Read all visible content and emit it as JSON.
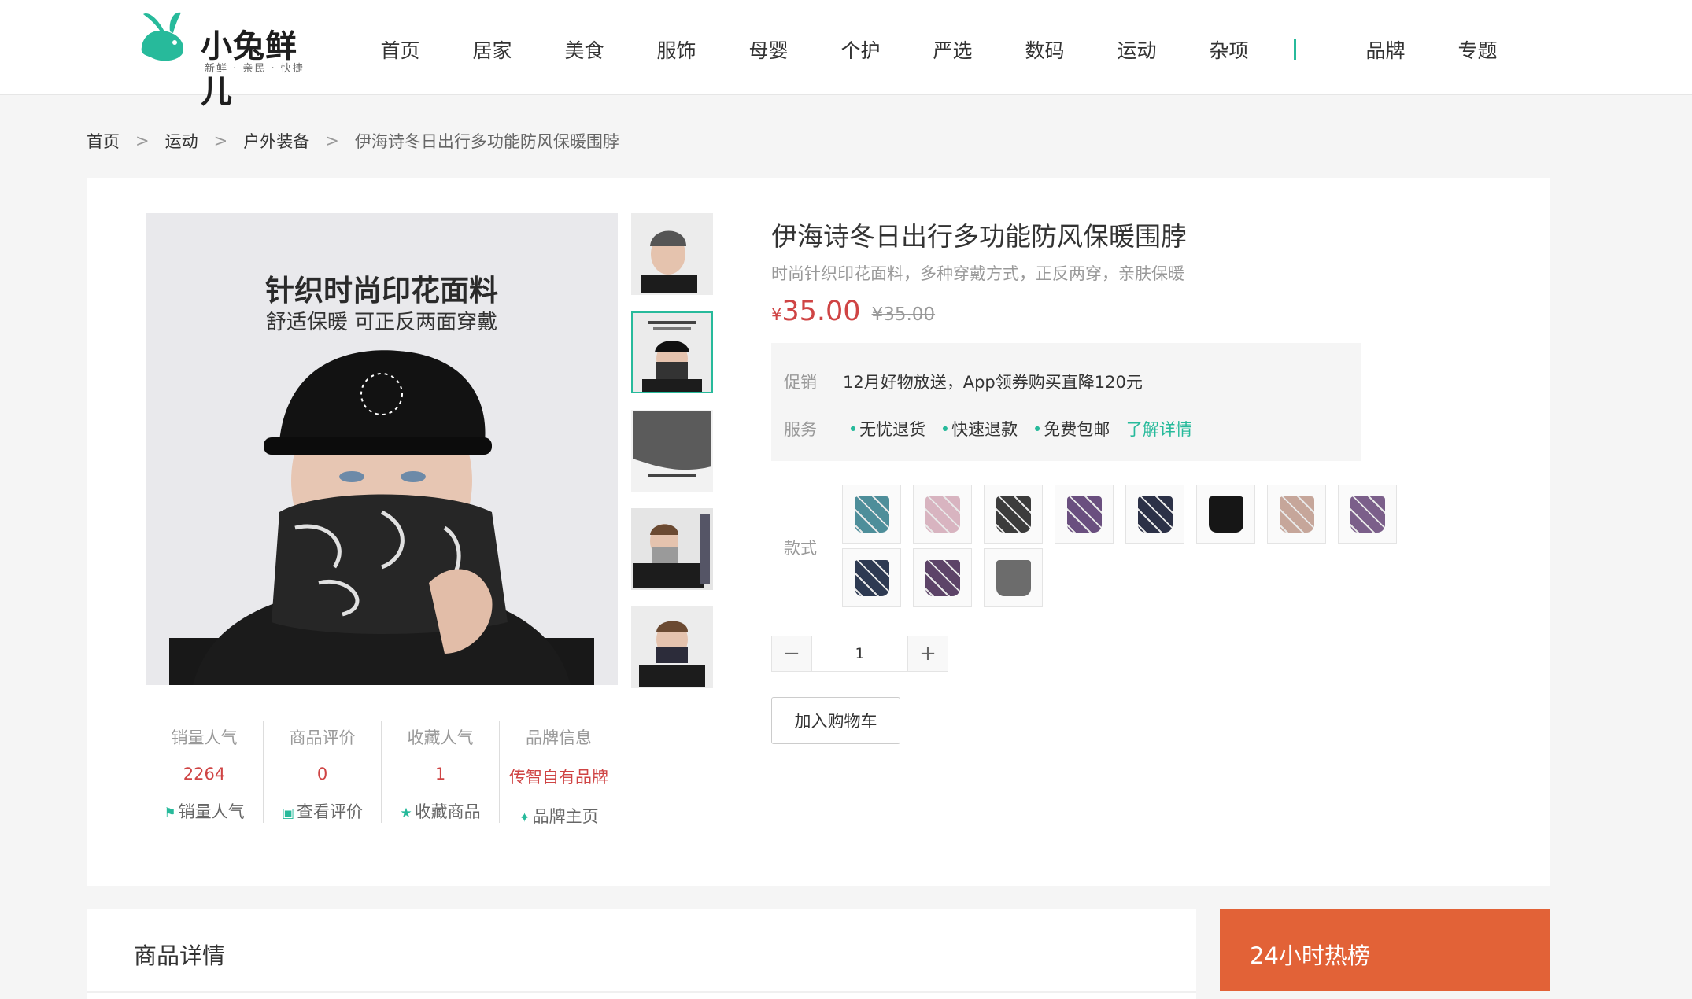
{
  "brand": {
    "name": "小兔鲜儿",
    "tagline": "新鲜 · 亲民 · 快捷"
  },
  "nav": {
    "items": [
      "首页",
      "居家",
      "美食",
      "服饰",
      "母婴",
      "个护",
      "严选",
      "数码",
      "运动",
      "杂项"
    ],
    "after": [
      "品牌",
      "专题"
    ]
  },
  "breadcrumb": [
    "首页",
    "运动",
    "户外装备",
    "伊海诗冬日出行多功能防风保暖围脖"
  ],
  "gallery": {
    "main_title": "针织时尚印花面料",
    "main_subtitle": "舒适保暖 可正反两面穿戴",
    "thumb_count": 5,
    "active_thumb": 1
  },
  "stats": [
    {
      "label": "销量人气",
      "value": "2264",
      "link": "销量人气",
      "icon": "flag-icon"
    },
    {
      "label": "商品评价",
      "value": "0",
      "link": "查看评价",
      "icon": "comment-icon"
    },
    {
      "label": "收藏人气",
      "value": "1",
      "link": "收藏商品",
      "icon": "star-icon"
    },
    {
      "label": "品牌信息",
      "value": "传智自有品牌",
      "link": "品牌主页",
      "icon": "brand-icon"
    }
  ],
  "product": {
    "title": "伊海诗冬日出行多功能防风保暖围脖",
    "desc": "时尚针织印花面料，多种穿戴方式，正反两穿，亲肤保暖",
    "currency": "¥",
    "price": "35.00",
    "old_price": "¥35.00"
  },
  "promo": {
    "promo_label": "促销",
    "promo_text": "12月好物放送，App领券购买直降120元",
    "service_label": "服务",
    "services": [
      "无忧退货",
      "快速退款",
      "免费包邮"
    ],
    "more": "了解详情"
  },
  "spec": {
    "label": "款式",
    "swatch_colors": [
      "#4e8e9a",
      "#d8b4c0",
      "#3c3c3c",
      "#6a4f7f",
      "#2c3147",
      "#161616",
      "#c6a69a",
      "#7b5f8a",
      "#2e3a52",
      "#5d4468",
      "#6c6c6c"
    ]
  },
  "quantity": {
    "minus": "−",
    "plus": "+",
    "value": "1"
  },
  "cart_button": "加入购物车",
  "detail": {
    "title": "商品详情"
  },
  "hot": {
    "title": "24小时热榜"
  },
  "colors": {
    "accent": "#27ba9b",
    "price": "#cf4444",
    "hot": "#e26237"
  }
}
